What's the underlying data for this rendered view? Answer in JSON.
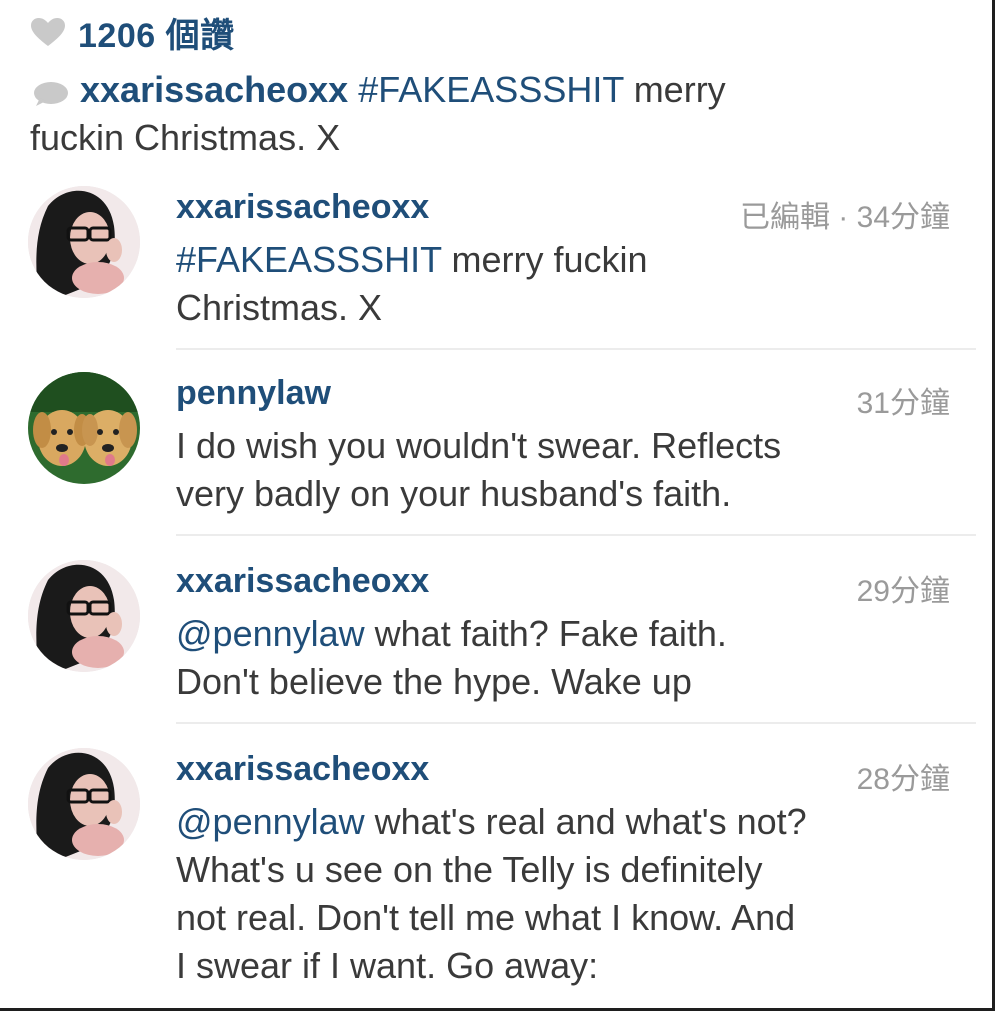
{
  "likes": {
    "count_text": "1206 個讚"
  },
  "caption": {
    "username": "xxarissacheoxx",
    "hashtag": "#FAKEASSSHIT",
    "text_line1": " merry",
    "text_line2": "fuckin Christmas. X"
  },
  "comments": [
    {
      "username": "xxarissacheoxx",
      "time": "已編輯 · 34分鐘",
      "hashtag": "#FAKEASSSHIT",
      "line1": " merry fuckin",
      "line2": "Christmas. X",
      "avatar": "woman-glasses-avatar"
    },
    {
      "username": "pennylaw",
      "time": "31分鐘",
      "line1": "I do wish you wouldn't swear. Reflects",
      "line2": "very badly on your husband's faith.",
      "avatar": "golden-retriever-puppies-avatar"
    },
    {
      "username": "xxarissacheoxx",
      "time": "29分鐘",
      "mention": "@pennylaw",
      "line1": " what faith? Fake faith.",
      "line2": "Don't believe the hype. Wake up",
      "avatar": "woman-glasses-avatar"
    },
    {
      "username": "xxarissacheoxx",
      "time": "28分鐘",
      "mention": "@pennylaw",
      "line1": " what's real and what's not?",
      "line2": "What's u see on the Telly is definitely",
      "line3": "not real. Don't tell me what I know. And",
      "line4": "I swear if I want. Go away:",
      "avatar": "woman-glasses-avatar"
    }
  ],
  "colors": {
    "link": "#1f4e79",
    "text": "#3a3a3a",
    "meta": "#9a9a9a"
  }
}
